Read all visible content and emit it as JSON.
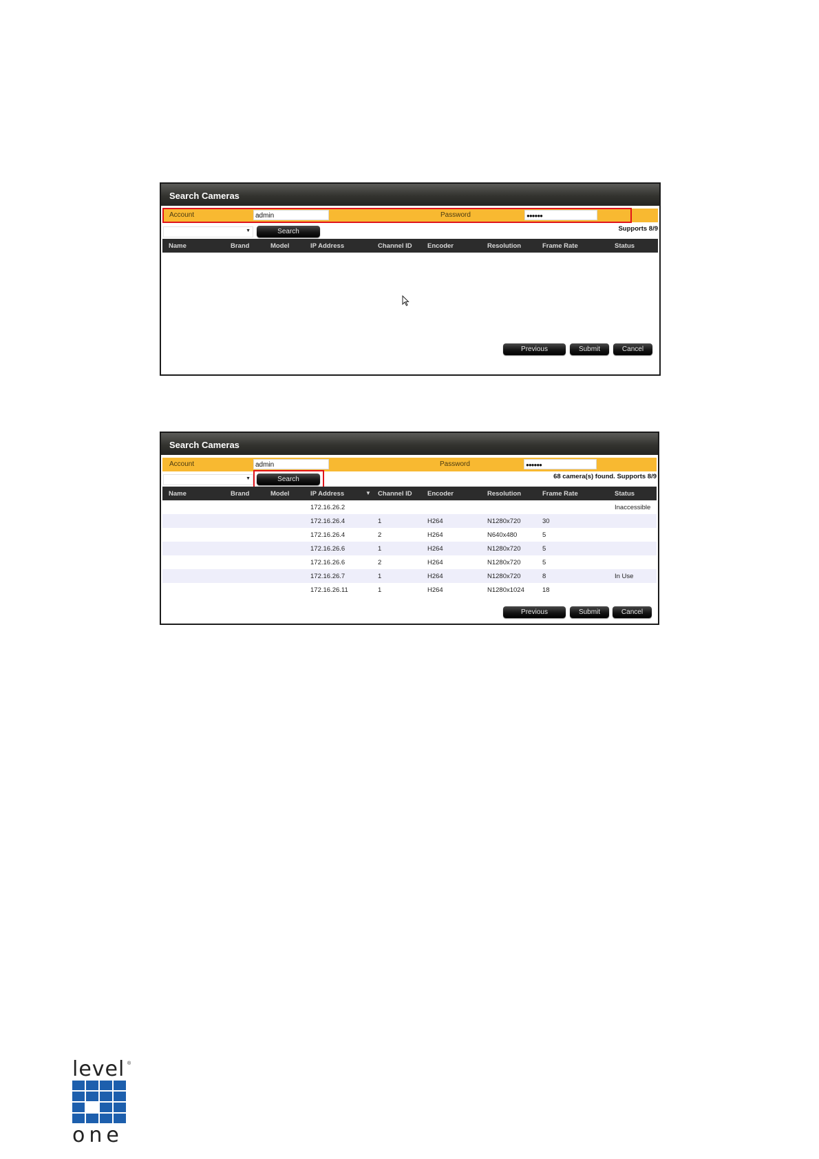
{
  "panel1": {
    "title": "Search Cameras",
    "account_label": "Account",
    "account_value": "admin",
    "password_label": "Password",
    "password_value": "●●●●●●",
    "search_label": "Search",
    "status_text": "Supports 8/9",
    "columns": [
      "Name",
      "Brand",
      "Model",
      "IP Address",
      "Channel ID",
      "Encoder",
      "Resolution",
      "Frame Rate",
      "Status"
    ],
    "buttons": {
      "previous": "Previous",
      "submit": "Submit",
      "cancel": "Cancel"
    }
  },
  "panel2": {
    "title": "Search Cameras",
    "account_label": "Account",
    "account_value": "admin",
    "password_label": "Password",
    "password_value": "●●●●●●",
    "search_label": "Search",
    "status_text": "68 camera(s) found.  Supports 8/9",
    "columns": [
      "Name",
      "Brand",
      "Model",
      "IP Address",
      "Channel ID",
      "Encoder",
      "Resolution",
      "Frame Rate",
      "Status"
    ],
    "rows": [
      {
        "ip": "172.16.26.2",
        "channel": "",
        "encoder": "",
        "resolution": "",
        "frame_rate": "",
        "status": "Inaccessible"
      },
      {
        "ip": "172.16.26.4",
        "channel": "1",
        "encoder": "H264",
        "resolution": "N1280x720",
        "frame_rate": "30",
        "status": ""
      },
      {
        "ip": "172.16.26.4",
        "channel": "2",
        "encoder": "H264",
        "resolution": "N640x480",
        "frame_rate": "5",
        "status": ""
      },
      {
        "ip": "172.16.26.6",
        "channel": "1",
        "encoder": "H264",
        "resolution": "N1280x720",
        "frame_rate": "5",
        "status": ""
      },
      {
        "ip": "172.16.26.6",
        "channel": "2",
        "encoder": "H264",
        "resolution": "N1280x720",
        "frame_rate": "5",
        "status": ""
      },
      {
        "ip": "172.16.26.7",
        "channel": "1",
        "encoder": "H264",
        "resolution": "N1280x720",
        "frame_rate": "8",
        "status": "In Use"
      },
      {
        "ip": "172.16.26.11",
        "channel": "1",
        "encoder": "H264",
        "resolution": "N1280x1024",
        "frame_rate": "18",
        "status": ""
      }
    ],
    "buttons": {
      "previous": "Previous",
      "submit": "Submit",
      "cancel": "Cancel"
    }
  },
  "logo": {
    "top": "level",
    "registered": "®",
    "bottom": "one"
  },
  "colors": {
    "accent": "#f8b931",
    "highlight": "#e0141b",
    "header": "#2c2c2c",
    "row_alt": "#eeeefa",
    "logo_blue": "#1d5fad"
  },
  "icons": [
    "chevron-down-icon",
    "mouse-pointer-icon",
    "sort-down-icon"
  ]
}
